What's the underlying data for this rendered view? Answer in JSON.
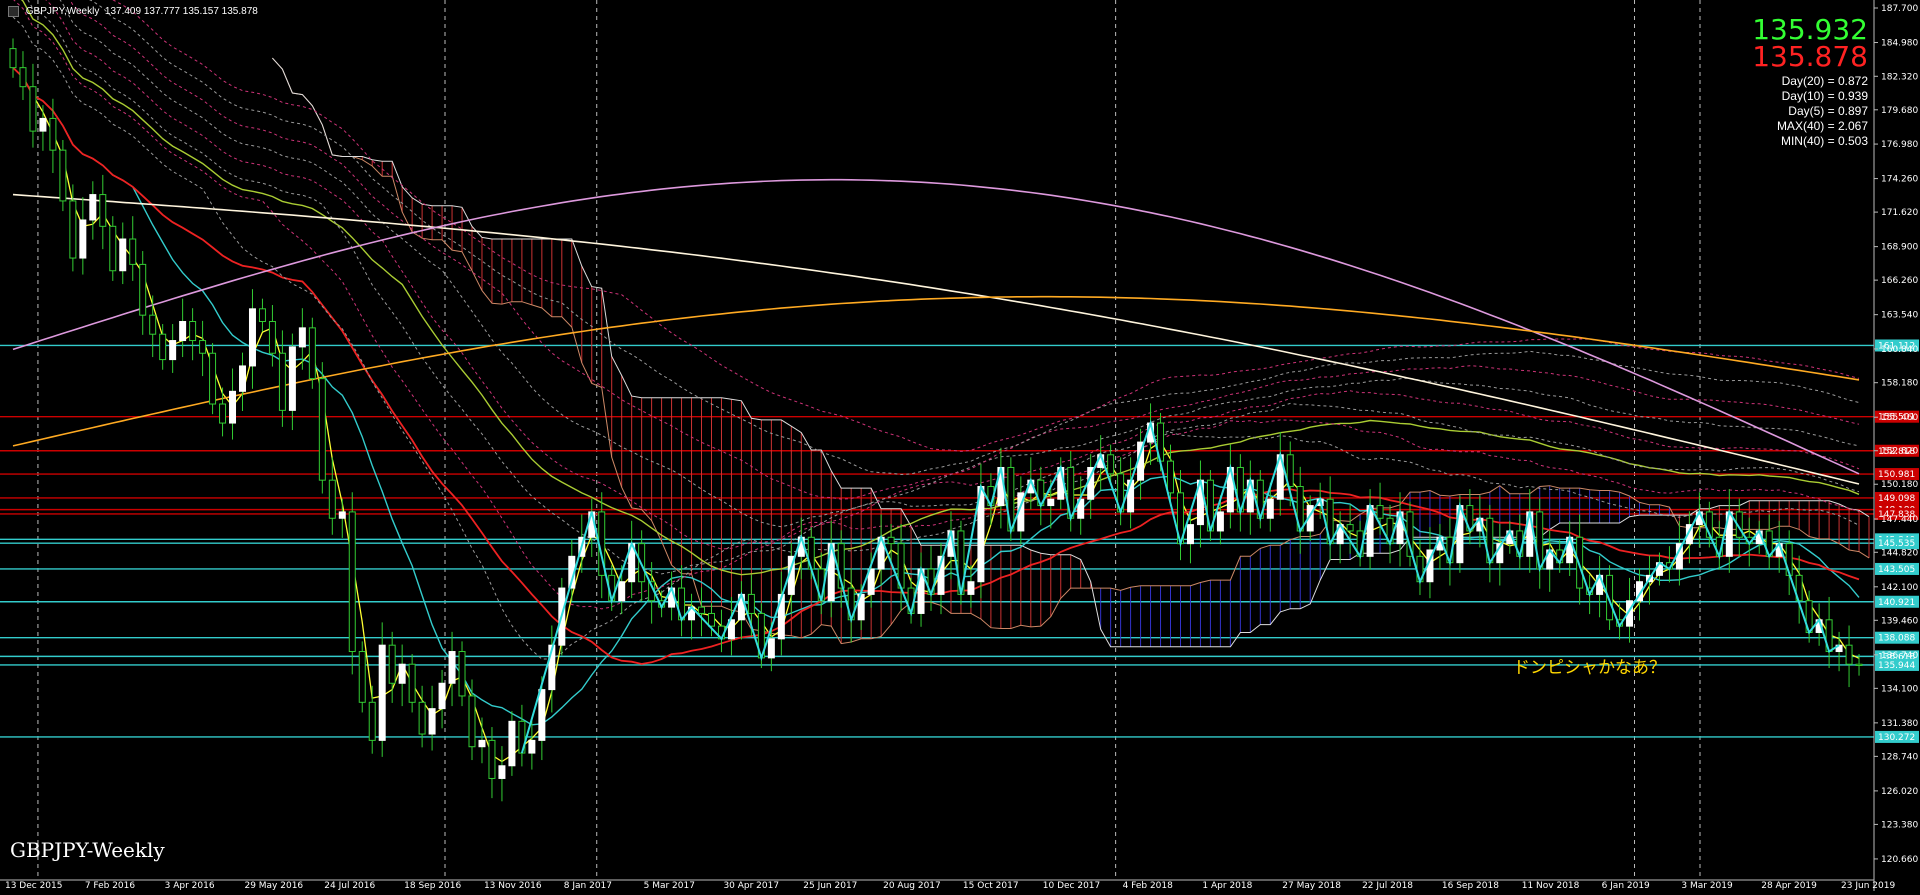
{
  "info_bar": {
    "symbol": "GBPJPY,Weekly",
    "ohlc": "137.409 137.777 135.157 135.878"
  },
  "quote": {
    "bid": "135.932",
    "ask": "135.878",
    "bid_color": "#33ff33",
    "ask_color": "#ff2222"
  },
  "stats": [
    "Day(20) = 0.872",
    "Day(10) = 0.939",
    "Day(5) = 0.897",
    "MAX(40) = 2.067",
    "MIN(40) = 0.503"
  ],
  "watermark": "GBPJPY-Weekly",
  "annotation": "ドンピシャかなあ？",
  "colors": {
    "background": "#000000",
    "bull": "#ffffff",
    "bear": "#33cc33",
    "grid": "#808080"
  },
  "chart_data": {
    "type": "candlestick",
    "symbol": "GBPJPY",
    "timeframe": "Weekly",
    "ylim": [
      119.0,
      187.7
    ],
    "y_ticks": [
      "187.700",
      "184.980",
      "182.320",
      "179.680",
      "176.980",
      "174.260",
      "171.620",
      "168.900",
      "166.260",
      "163.540",
      "160.840",
      "158.180",
      "155.460",
      "152.820",
      "150.180",
      "147.440",
      "144.820",
      "142.100",
      "139.460",
      "136.740",
      "134.100",
      "131.380",
      "128.740",
      "126.020",
      "123.380",
      "120.660"
    ],
    "x_labels": [
      "13 Dec 2015",
      "7 Feb 2016",
      "3 Apr 2016",
      "29 May 2016",
      "24 Jul 2016",
      "18 Sep 2016",
      "13 Nov 2016",
      "8 Jan 2017",
      "5 Mar 2017",
      "30 Apr 2017",
      "25 Jun 2017",
      "20 Aug 2017",
      "15 Oct 2017",
      "10 Dec 2017",
      "4 Feb 2018",
      "1 Apr 2018",
      "27 May 2018",
      "22 Jul 2018",
      "16 Sep 2018",
      "11 Nov 2018",
      "6 Jan 2019",
      "3 Mar 2019",
      "28 Apr 2019",
      "23 Jun 2019"
    ],
    "x_label_week": [
      0,
      8,
      16,
      24,
      32,
      40,
      48,
      56,
      64,
      72,
      80,
      88,
      96,
      104,
      112,
      120,
      128,
      136,
      144,
      152,
      160,
      168,
      176,
      184
    ],
    "weeks_total": 187,
    "closes": [
      183.0,
      181.5,
      178.0,
      179.0,
      176.5,
      172.5,
      168.0,
      171.0,
      173.0,
      170.5,
      167.0,
      169.5,
      167.5,
      163.5,
      162.0,
      160.0,
      161.5,
      163.0,
      161.5,
      160.5,
      156.5,
      155.0,
      157.5,
      159.5,
      164.0,
      163.0,
      160.5,
      156.0,
      161.0,
      162.5,
      158.5,
      150.5,
      147.5,
      148.0,
      137.0,
      133.0,
      130.0,
      137.5,
      134.5,
      136.0,
      133.0,
      130.5,
      132.5,
      134.5,
      137.0,
      133.5,
      129.5,
      130.0,
      127.0,
      128.0,
      131.5,
      129.0,
      130.0,
      134.0,
      137.5,
      142.0,
      144.5,
      146.0,
      148.0,
      143.0,
      141.0,
      142.5,
      145.5,
      142.5,
      141.0,
      140.5,
      142.0,
      139.5,
      140.5,
      140.0,
      139.0,
      138.0,
      139.5,
      141.5,
      140.0,
      136.5,
      138.0,
      141.5,
      144.5,
      146.0,
      143.5,
      141.0,
      145.5,
      142.0,
      139.5,
      141.5,
      143.5,
      146.0,
      145.5,
      142.0,
      140.0,
      143.5,
      141.5,
      144.5,
      146.5,
      141.5,
      142.5,
      150.0,
      148.5,
      151.5,
      146.5,
      149.5,
      150.5,
      148.5,
      149.0,
      151.5,
      147.5,
      149.0,
      151.5,
      152.5,
      151.0,
      148.0,
      150.5,
      153.5,
      155.0,
      152.0,
      149.5,
      145.5,
      147.0,
      150.5,
      146.5,
      148.0,
      151.5,
      148.0,
      150.5,
      147.5,
      149.0,
      152.5,
      150.0,
      146.5,
      148.5,
      149.0,
      145.5,
      147.0,
      146.5,
      144.5,
      148.5,
      147.5,
      145.5,
      148.0,
      144.5,
      142.5,
      145.0,
      146.0,
      144.0,
      148.5,
      146.5,
      147.5,
      144.0,
      145.5,
      146.5,
      144.5,
      148.0,
      143.5,
      145.0,
      144.0,
      146.0,
      142.0,
      141.5,
      143.0,
      139.5,
      139.0,
      141.0,
      142.5,
      143.0,
      144.0,
      143.5,
      145.5,
      147.0,
      148.0,
      146.0,
      144.5,
      148.0,
      146.0,
      145.5,
      146.5,
      144.5,
      145.5,
      143.0,
      141.0,
      138.5,
      139.5,
      137.0,
      137.5,
      136.0,
      135.9
    ],
    "levels": [
      {
        "label": "161.112",
        "color": "#33cccc"
      },
      {
        "label": "155.501",
        "color": "#cc0000"
      },
      {
        "label": "152.818",
        "color": "#cc0000"
      },
      {
        "label": "150.981",
        "color": "#cc0000"
      },
      {
        "label": "149.098",
        "color": "#cc0000"
      },
      {
        "label": "148.180",
        "color": "#cc0000"
      },
      {
        "label": "147.838",
        "color": "#cc0000"
      },
      {
        "label": "145.840",
        "color": "#33cccc"
      },
      {
        "label": "145.535",
        "color": "#33cccc"
      },
      {
        "label": "143.505",
        "color": "#33cccc"
      },
      {
        "label": "140.921",
        "color": "#33cccc"
      },
      {
        "label": "138.088",
        "color": "#33cccc"
      },
      {
        "label": "136.618",
        "color": "#33cccc"
      },
      {
        "label": "135.944",
        "color": "#33cccc"
      },
      {
        "label": "130.272",
        "color": "#33cccc"
      }
    ]
  }
}
